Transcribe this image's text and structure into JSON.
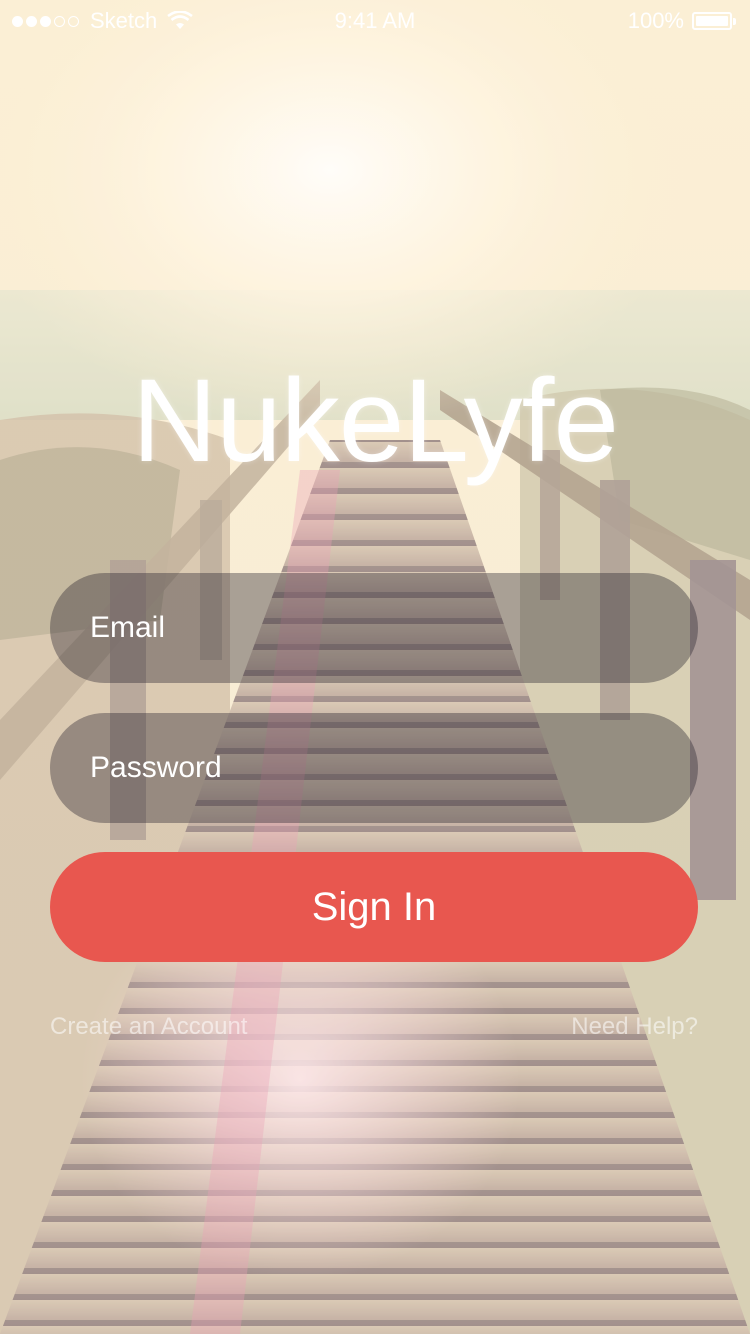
{
  "status_bar": {
    "carrier": "Sketch",
    "time": "9:41 AM",
    "battery": "100%",
    "signal_bars_filled": 3,
    "signal_bars_total": 5
  },
  "app": {
    "title": "NukeLyfe"
  },
  "form": {
    "email_placeholder": "Email",
    "password_placeholder": "Password",
    "sign_in_label": "Sign In"
  },
  "links": {
    "create_account": "Create an Account",
    "need_help": "Need Help?"
  },
  "colors": {
    "accent": "#e8574f",
    "field_bg": "rgba(40,35,45,0.38)"
  }
}
